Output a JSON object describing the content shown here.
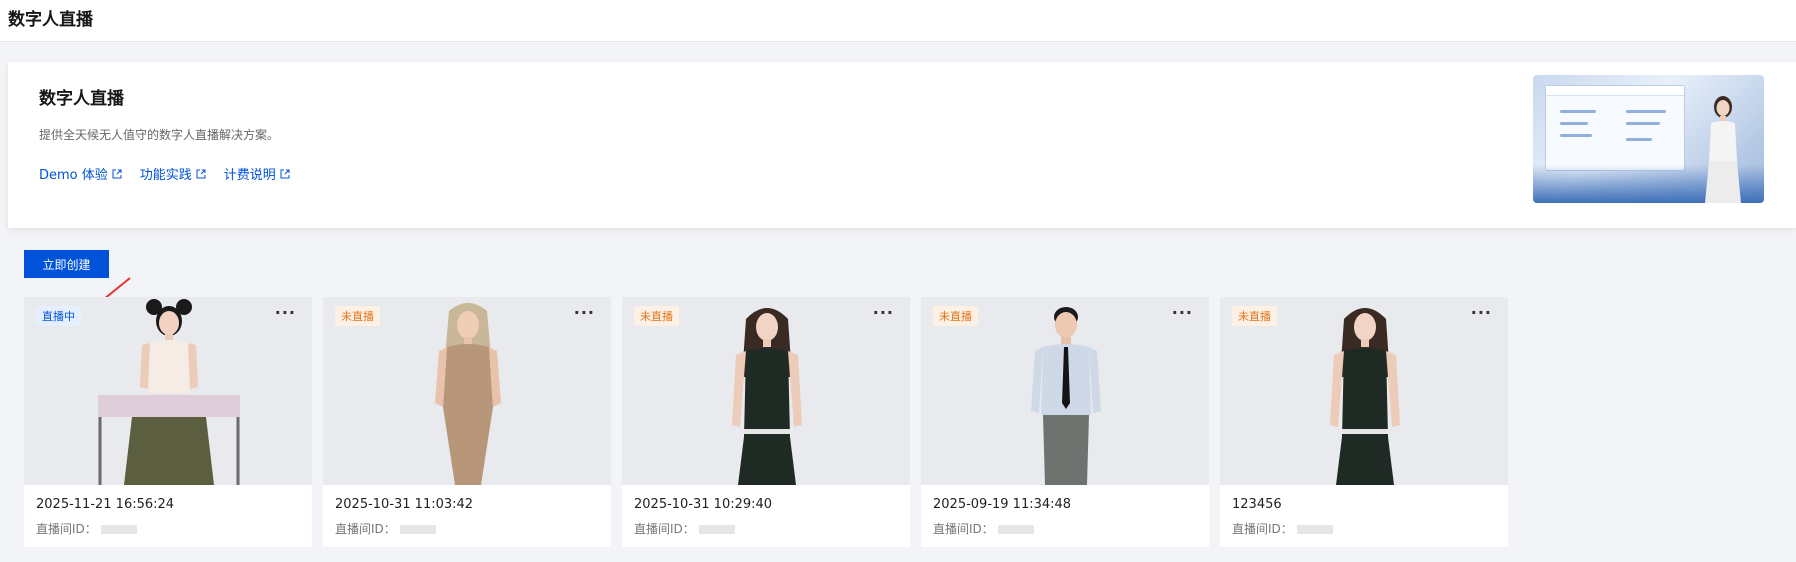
{
  "header": {
    "title": "数字人直播"
  },
  "intro": {
    "title": "数字人直播",
    "description": "提供全天候无人值守的数字人直播解决方案。",
    "links": [
      {
        "label": "Demo 体验",
        "icon": "external-link-icon"
      },
      {
        "label": "功能实践",
        "icon": "external-link-icon"
      },
      {
        "label": "计费说明",
        "icon": "external-link-icon"
      }
    ]
  },
  "toolbar": {
    "create_label": "立即创建"
  },
  "colors": {
    "primary": "#0052d9",
    "live_badge_bg": "#e6efff",
    "off_badge_bg": "#fdf0e4",
    "off_badge_text": "#e37318"
  },
  "cards": [
    {
      "status": "直播中",
      "status_type": "live",
      "title": "2025-11-21 16:56:24",
      "room_id_label": "直播间ID：",
      "more": "···",
      "avatar": "woman-seated-white-top"
    },
    {
      "status": "未直播",
      "status_type": "off",
      "title": "2025-10-31 11:03:42",
      "room_id_label": "直播间ID：",
      "more": "···",
      "avatar": "woman-blonde-beige-dress"
    },
    {
      "status": "未直播",
      "status_type": "off",
      "title": "2025-10-31 10:29:40",
      "room_id_label": "直播间ID：",
      "more": "···",
      "avatar": "woman-black-dress"
    },
    {
      "status": "未直播",
      "status_type": "off",
      "title": "2025-09-19 11:34:48",
      "room_id_label": "直播间ID：",
      "more": "···",
      "avatar": "man-shirt-tie"
    },
    {
      "status": "未直播",
      "status_type": "off",
      "title": "123456",
      "room_id_label": "直播间ID：",
      "more": "···",
      "avatar": "woman-black-dress"
    }
  ]
}
